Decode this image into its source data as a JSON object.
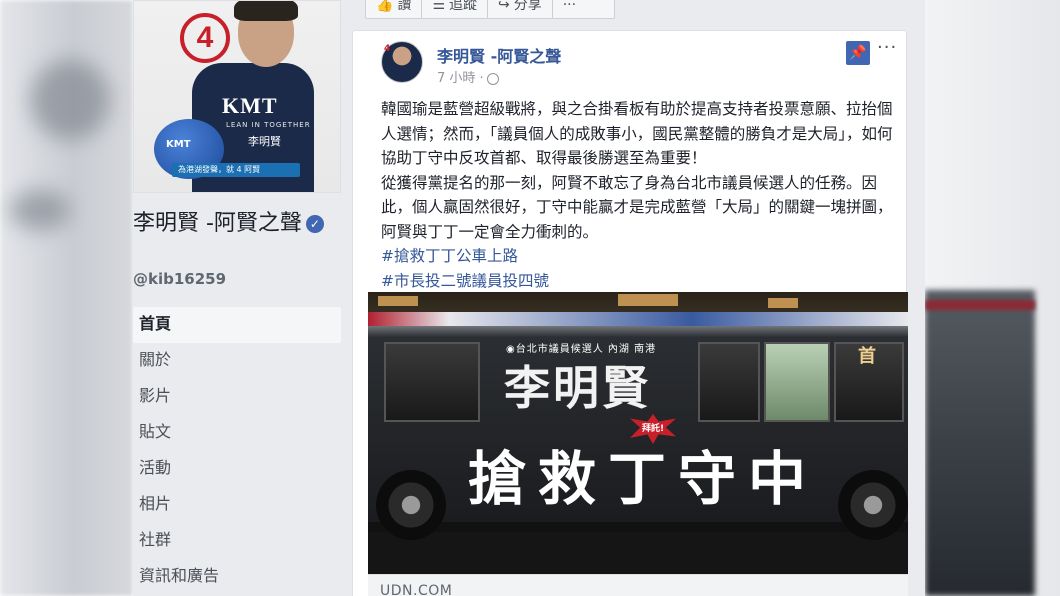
{
  "sidebar": {
    "cover": {
      "number_badge": "4",
      "shirt_logo": "KMT",
      "shirt_sub": "LEAN IN TOGETHER",
      "shirt_name": "李明賢",
      "ball_text": "KMT",
      "banner_text": "為港湖發聲，就 4 阿賢"
    },
    "page_name": "李明賢 -阿賢之聲",
    "verified_icon": "✓",
    "handle": "@kib16259",
    "nav": [
      {
        "label": "首頁",
        "active": true
      },
      {
        "label": "關於"
      },
      {
        "label": "影片"
      },
      {
        "label": "貼文"
      },
      {
        "label": "活動"
      },
      {
        "label": "相片"
      },
      {
        "label": "社群"
      },
      {
        "label": "資訊和廣告"
      }
    ]
  },
  "action_bar": {
    "like": "讚",
    "follow": "追蹤",
    "share": "分享",
    "more": "···"
  },
  "post": {
    "avatar_badge": "4",
    "author": "李明賢 -阿賢之聲",
    "time": "7 小時 ·",
    "more": "···",
    "pin_icon": "📌",
    "paragraphs": [
      "韓國瑜是藍營超級戰將，與之合掛看板有助於提高支持者投票意願、拉抬個人選情；然而，「議員個人的成敗事小，國民黨整體的勝負才是大局」，如何協助丁守中反攻首都、取得最後勝選至為重要！",
      "從獲得黨提名的那一刻，阿賢不敢忘了身為台北市議員候選人的任務。因此，個人贏固然很好，丁守中能贏才是完成藍營「大局」的關鍵一塊拼圖，阿賢與丁丁一定會全力衝刺的。"
    ],
    "hashtags": [
      "#搶救丁丁公車上路",
      "#市長投二號議員投四號"
    ],
    "photo": {
      "small_label": "◉台北市議員候選人 內湖 南港",
      "name": "李明賢",
      "burst": "拜託!",
      "slogan": "搶救丁守中",
      "side_char": "首"
    },
    "link_domain": "UDN.COM"
  }
}
